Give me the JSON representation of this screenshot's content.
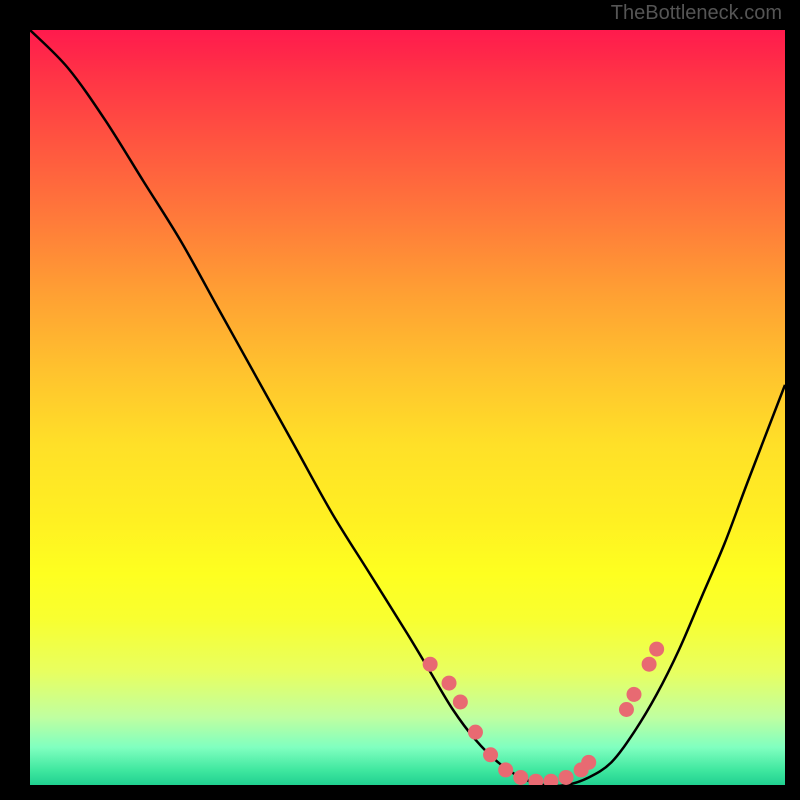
{
  "watermark": "TheBottleneck.com",
  "chart_data": {
    "type": "line",
    "title": "",
    "xlabel": "",
    "ylabel": "",
    "xlim": [
      0,
      100
    ],
    "ylim": [
      0,
      100
    ],
    "series": [
      {
        "name": "bottleneck-curve",
        "x": [
          0,
          5,
          10,
          15,
          20,
          25,
          30,
          35,
          40,
          45,
          50,
          53,
          56,
          59,
          62,
          65,
          68,
          71,
          74,
          77,
          80,
          83,
          86,
          89,
          92,
          95,
          100
        ],
        "y": [
          100,
          95,
          88,
          80,
          72,
          63,
          54,
          45,
          36,
          28,
          20,
          15,
          10,
          6,
          3,
          1,
          0,
          0,
          1,
          3,
          7,
          12,
          18,
          25,
          32,
          40,
          53
        ]
      }
    ],
    "markers": {
      "name": "highlight-points",
      "x": [
        53,
        55.5,
        57,
        59,
        61,
        63,
        65,
        67,
        69,
        71,
        73,
        74,
        79,
        80,
        82,
        83
      ],
      "y": [
        16,
        13.5,
        11,
        7,
        4,
        2,
        1,
        0.5,
        0.5,
        1,
        2,
        3,
        10,
        12,
        16,
        18
      ]
    },
    "gradient_stops": [
      {
        "pos": 0,
        "color": "#ff1a4d"
      },
      {
        "pos": 50,
        "color": "#ffe028"
      },
      {
        "pos": 100,
        "color": "#20d090"
      }
    ]
  }
}
